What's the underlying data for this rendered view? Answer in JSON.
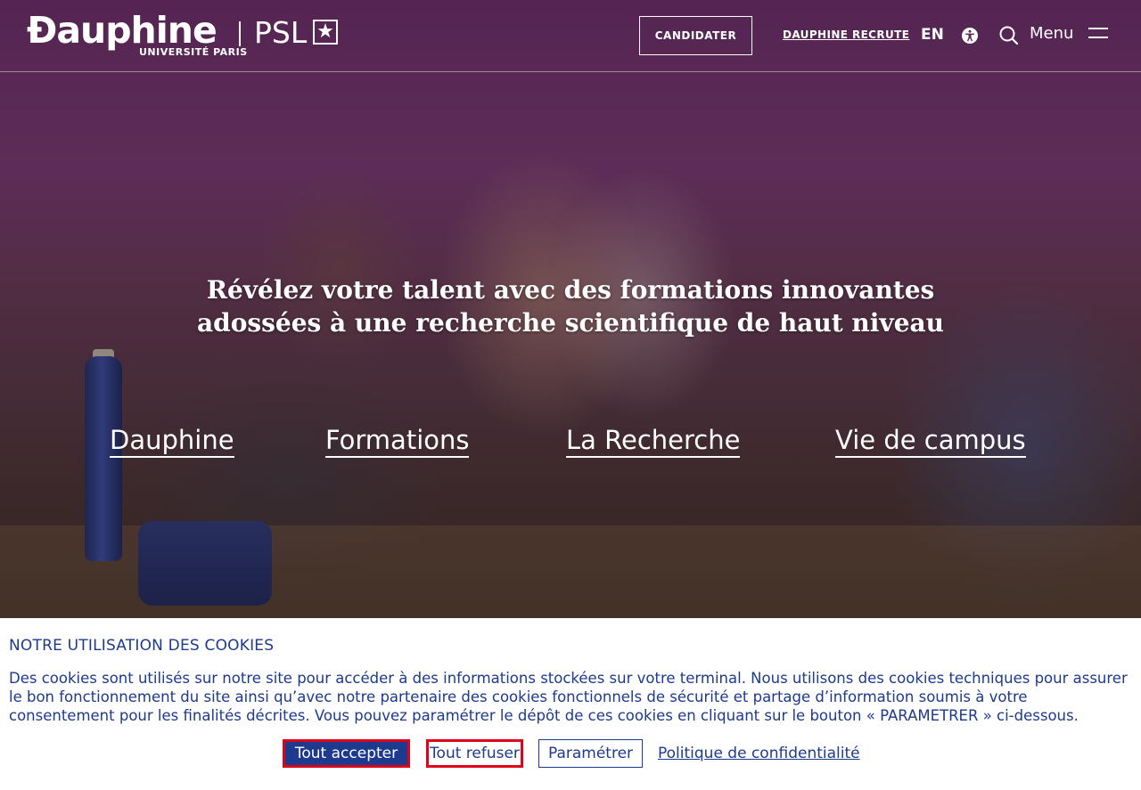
{
  "header": {
    "logo_word": "Ɖauphine",
    "logo_sub": "UNIVERSITÉ PARIS",
    "logo_psl": "PSL",
    "candidater_label": "CANDIDATER",
    "recrute_label": "DAUPHINE RECRUTE",
    "lang_label": "EN",
    "menu_label": "Menu",
    "icons": [
      "accessibility-icon",
      "search-icon",
      "hamburger-menu-icon"
    ]
  },
  "hero": {
    "headline_line1": "Révélez votre talent avec des formations innovantes",
    "headline_line2": "adossées à une recherche scientifique de haut niveau",
    "links": [
      "Dauphine",
      "Formations",
      "La Recherche",
      "Vie de campus"
    ]
  },
  "cookie": {
    "title": "NOTRE UTILISATION DES COOKIES",
    "text": "Des cookies sont utilisés sur notre site pour accéder à des informations stockées sur votre terminal. Nous utilisons des cookies techniques pour assurer le bon fonctionnement du site ainsi qu’avec notre partenaire des cookies fonctionnels de sécurité et partage d’information soumis à votre consentement pour les finalités décrites. Vous pouvez paramétrer le dépôt de ces cookies en cliquant sur le bouton « PARAMETRER » ci-dessous.",
    "accept_label": "Tout accepter",
    "refuse_label": "Tout refuser",
    "param_label": "Paramétrer",
    "policy_label": "Politique de confidentialité"
  },
  "colors": {
    "brand_blue": "#1d3a8f",
    "highlight_red": "#e0001a",
    "white": "#ffffff"
  }
}
